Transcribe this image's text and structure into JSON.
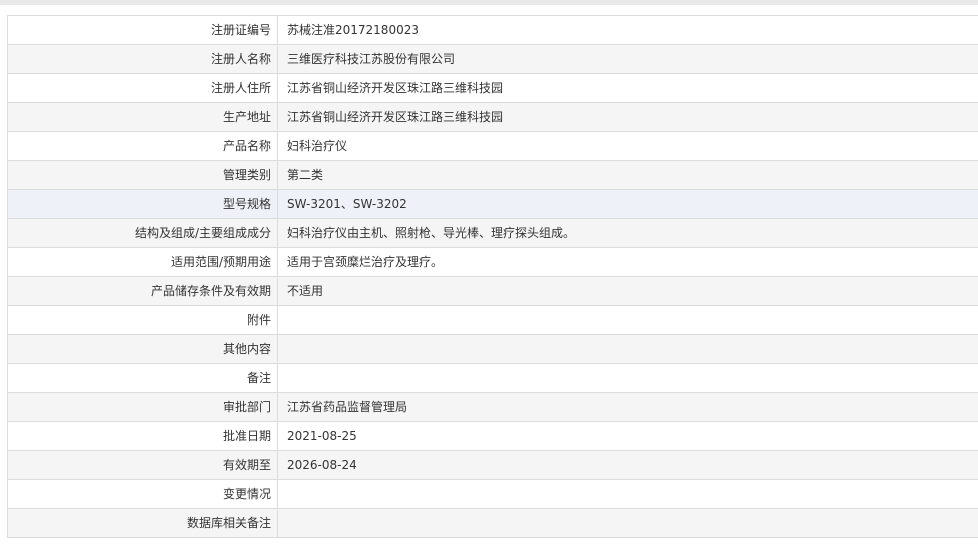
{
  "rows": [
    {
      "label": "注册证编号",
      "value": "苏械注准20172180023"
    },
    {
      "label": "注册人名称",
      "value": "三维医疗科技江苏股份有限公司"
    },
    {
      "label": "注册人住所",
      "value": "江苏省铜山经济开发区珠江路三维科技园"
    },
    {
      "label": "生产地址",
      "value": "江苏省铜山经济开发区珠江路三维科技园"
    },
    {
      "label": "产品名称",
      "value": "妇科治疗仪"
    },
    {
      "label": "管理类别",
      "value": "第二类"
    },
    {
      "label": "型号规格",
      "value": "SW-3201、SW-3202"
    },
    {
      "label": "结构及组成/主要组成成分",
      "value": "妇科治疗仪由主机、照射枪、导光棒、理疗探头组成。"
    },
    {
      "label": "适用范围/预期用途",
      "value": "适用于宫颈糜烂治疗及理疗。"
    },
    {
      "label": "产品储存条件及有效期",
      "value": "不适用"
    },
    {
      "label": "附件",
      "value": ""
    },
    {
      "label": "其他内容",
      "value": ""
    },
    {
      "label": "备注",
      "value": ""
    },
    {
      "label": "审批部门",
      "value": "江苏省药品监督管理局"
    },
    {
      "label": "批准日期",
      "value": "2021-08-25"
    },
    {
      "label": "有效期至",
      "value": "2026-08-24"
    },
    {
      "label": "变更情况",
      "value": ""
    },
    {
      "label": "数据库相关备注",
      "value": ""
    }
  ]
}
